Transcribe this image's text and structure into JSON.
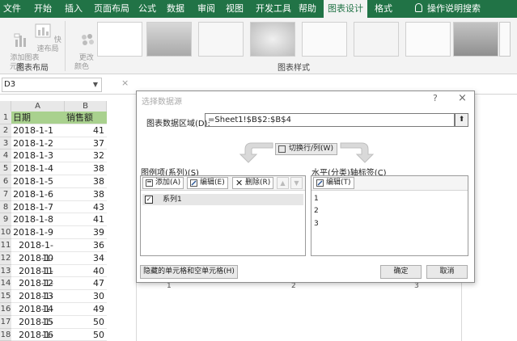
{
  "ribbon_tabs": [
    "文件",
    "开始",
    "插入",
    "页面布局",
    "公式",
    "数据",
    "审阅",
    "视图",
    "开发工具",
    "帮助",
    "图表设计",
    "格式",
    "操作说明搜索"
  ],
  "ribbon": {
    "add_chart_element": "添加图表\n元素",
    "quick_layout": "快速布局",
    "change_colors": "更改\n颜色",
    "group_chart_layout": "图表布局",
    "group_chart_styles": "图表样式"
  },
  "formula_bar": {
    "name_box": "D3",
    "cancel_symbol": "×"
  },
  "sheet": {
    "columns": [
      "A",
      "B"
    ],
    "header": {
      "a": "日期",
      "b": "销售额"
    },
    "rows": [
      {
        "n": "1",
        "a": "",
        "b": ""
      },
      {
        "n": "2",
        "a": "2018-1-1",
        "b": "41"
      },
      {
        "n": "3",
        "a": "2018-1-2",
        "b": "37"
      },
      {
        "n": "4",
        "a": "2018-1-3",
        "b": "32"
      },
      {
        "n": "5",
        "a": "2018-1-4",
        "b": "38"
      },
      {
        "n": "6",
        "a": "2018-1-5",
        "b": "38"
      },
      {
        "n": "7",
        "a": "2018-1-6",
        "b": "38"
      },
      {
        "n": "8",
        "a": "2018-1-7",
        "b": "43"
      },
      {
        "n": "9",
        "a": "2018-1-8",
        "b": "41"
      },
      {
        "n": "10",
        "a": "2018-1-9",
        "b": "39"
      },
      {
        "n": "11",
        "a": "2018-1-10",
        "b": "36"
      },
      {
        "n": "12",
        "a": "2018-1-11",
        "b": "34"
      },
      {
        "n": "13",
        "a": "2018-1-12",
        "b": "40"
      },
      {
        "n": "14",
        "a": "2018-1-13",
        "b": "47"
      },
      {
        "n": "15",
        "a": "2018-1-14",
        "b": "30"
      },
      {
        "n": "16",
        "a": "2018-1-15",
        "b": "49"
      },
      {
        "n": "17",
        "a": "2018-1-16",
        "b": "50"
      },
      {
        "n": "18",
        "a": "2018-1-17",
        "b": "50"
      }
    ]
  },
  "chart_ticks": [
    "1",
    "2",
    "3"
  ],
  "dialog": {
    "title": "选择数据源",
    "help": "?",
    "close": "×",
    "range_label": "图表数据区域(D):",
    "range_value": "=Sheet1!$B$2:$B$4",
    "switch_label": "切换行/列(W)",
    "legend_label": "图例项(系列)(S)",
    "add": "添加(A)",
    "edit": "编辑(E)",
    "remove": "删除(R)",
    "series": [
      "系列1"
    ],
    "axis_label": "水平(分类)轴标签(C)",
    "axis_edit": "编辑(T)",
    "categories": [
      "1",
      "2",
      "3"
    ],
    "hidden_cells": "隐藏的单元格和空单元格(H)",
    "ok": "确定",
    "cancel": "取消"
  }
}
